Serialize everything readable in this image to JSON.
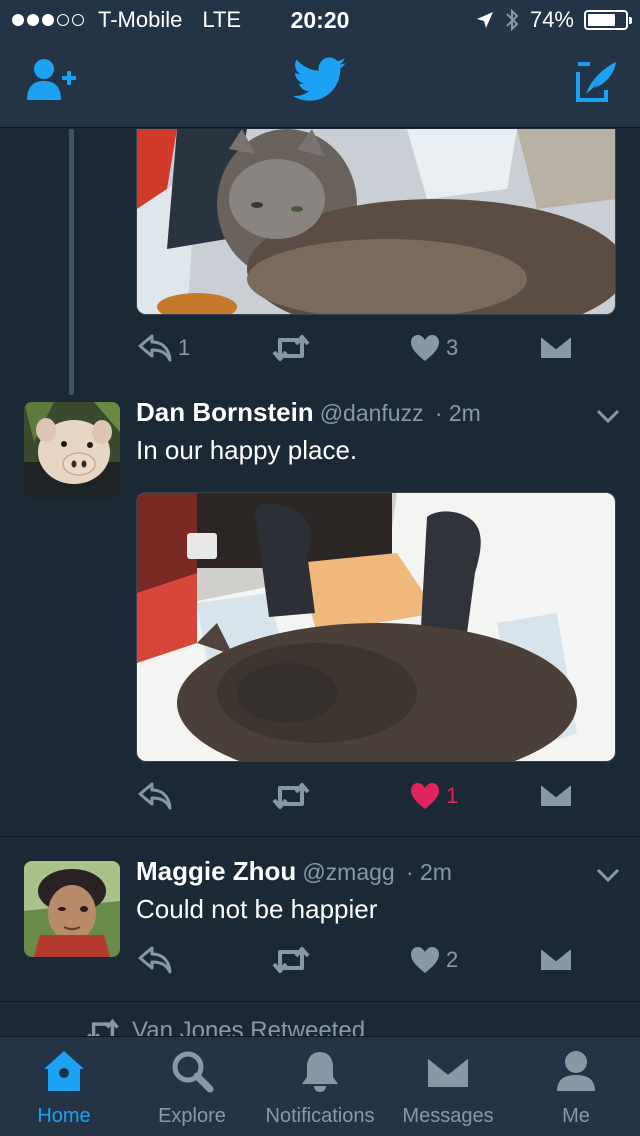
{
  "status_bar": {
    "carrier": "T-Mobile",
    "network": "LTE",
    "time": "20:20",
    "battery_percent": "74%",
    "battery_level": 0.74,
    "signal_bars_filled": 3,
    "signal_bars_total": 5
  },
  "colors": {
    "accent": "#1da1f2",
    "background": "#1b2836",
    "bar": "#243447",
    "secondary_text": "#8899a6",
    "like": "#e0245e"
  },
  "nav": {
    "left_icon": "add-user-icon",
    "center_icon": "twitter-bird-icon",
    "right_icon": "compose-tweet-icon"
  },
  "tweets": [
    {
      "media": "photo-gray-cat-lying-on-lap",
      "actions": {
        "reply_count": "1",
        "retweet_count": "",
        "like_count": "3",
        "liked": false
      }
    },
    {
      "name": "Dan Bornstein",
      "handle": "@danfuzz",
      "time": "· 2m",
      "text": "In our happy place.",
      "avatar": "pig-plush-avatar",
      "media": "photo-socked-feet-and-cat",
      "actions": {
        "reply_count": "",
        "retweet_count": "",
        "like_count": "1",
        "liked": true
      }
    },
    {
      "name": "Maggie Zhou",
      "handle": "@zmagg",
      "time": "· 2m",
      "text": "Could not be happier",
      "avatar": "selfie-avatar",
      "actions": {
        "reply_count": "",
        "retweet_count": "",
        "like_count": "2",
        "liked": false
      }
    }
  ],
  "retweet_notice": "Van Jones Retweeted",
  "tabs": [
    {
      "label": "Home",
      "icon": "home-icon",
      "active": true
    },
    {
      "label": "Explore",
      "icon": "search-icon",
      "active": false
    },
    {
      "label": "Notifications",
      "icon": "bell-icon",
      "active": false
    },
    {
      "label": "Messages",
      "icon": "envelope-icon",
      "active": false
    },
    {
      "label": "Me",
      "icon": "person-icon",
      "active": false
    }
  ]
}
